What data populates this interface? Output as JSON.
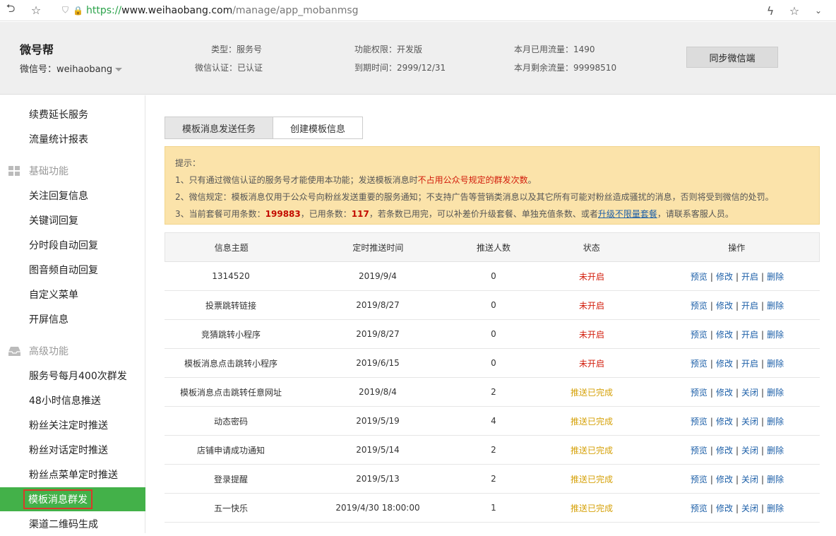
{
  "browser": {
    "url_scheme": "https://",
    "url_host": "www.weihaobang.com",
    "url_path": "/manage/app_mobanmsg"
  },
  "header": {
    "brand": "微号帮",
    "wxid_label": "微信号：weihaobang",
    "type": "类型：服务号",
    "auth": "微信认证：已认证",
    "permission": "功能权限：开发版",
    "expire": "到期时间：2999/12/31",
    "used_flow": "本月已用流量：1490",
    "left_flow": "本月剩余流量：99998510",
    "sync_button": "同步微信端"
  },
  "sidebar": {
    "items_top": [
      "续费延长服务",
      "流量统计报表"
    ],
    "section_basic": "基础功能",
    "items_basic": [
      "关注回复信息",
      "关键词回复",
      "分时段自动回复",
      "图音频自动回复",
      "自定义菜单",
      "开屏信息"
    ],
    "section_advanced": "高级功能",
    "items_advanced": [
      "服务号每月400次群发",
      "48小时信息推送",
      "粉丝关注定时推送",
      "粉丝对话定时推送",
      "粉丝点菜单定时推送"
    ],
    "active_item": "模板消息群发",
    "item_after": "渠道二维码生成"
  },
  "tabs": [
    "模板消息发送任务",
    "创建模板信息"
  ],
  "notice": {
    "title": "提示：",
    "line1_a": "1、只有通过微信认证的服务号才能使用本功能；发送模板消息时",
    "line1_red": "不占用公众号规定的群发次数",
    "line1_b": "。",
    "line2": "2、微信规定：模板消息仅用于公众号向粉丝发送重要的服务通知；不支持广告等营销类消息以及其它所有可能对粉丝造成骚扰的消息，否则将受到微信的处罚。",
    "line3_a": "3、当前套餐可用条数：",
    "line3_avail": "199883",
    "line3_b": "，已用条数：",
    "line3_used": "117",
    "line3_c": "，若条数已用完，可以补差价升级套餐、单独充值条数、或者",
    "line3_link": "升级不限量套餐",
    "line3_d": "，请联系客服人员。"
  },
  "table": {
    "headers": [
      "信息主题",
      "定时推送时间",
      "推送人数",
      "状态",
      "操作"
    ],
    "rows": [
      {
        "topic": "1314520",
        "time": "2019/9/4",
        "count": "0",
        "status": "未开启",
        "ops": [
          "预览",
          "修改",
          "开启",
          "删除"
        ]
      },
      {
        "topic": "投票跳转链接",
        "time": "2019/8/27",
        "count": "0",
        "status": "未开启",
        "ops": [
          "预览",
          "修改",
          "开启",
          "删除"
        ]
      },
      {
        "topic": "竞猜跳转小程序",
        "time": "2019/8/27",
        "count": "0",
        "status": "未开启",
        "ops": [
          "预览",
          "修改",
          "开启",
          "删除"
        ]
      },
      {
        "topic": "模板消息点击跳转小程序",
        "time": "2019/6/15",
        "count": "0",
        "status": "未开启",
        "ops": [
          "预览",
          "修改",
          "开启",
          "删除"
        ]
      },
      {
        "topic": "模板消息点击跳转任意网址",
        "time": "2019/8/4",
        "count": "2",
        "status": "推送已完成",
        "ops": [
          "预览",
          "修改",
          "关闭",
          "删除"
        ]
      },
      {
        "topic": "动态密码",
        "time": "2019/5/19",
        "count": "4",
        "status": "推送已完成",
        "ops": [
          "预览",
          "修改",
          "关闭",
          "删除"
        ]
      },
      {
        "topic": "店铺申请成功通知",
        "time": "2019/5/14",
        "count": "2",
        "status": "推送已完成",
        "ops": [
          "预览",
          "修改",
          "关闭",
          "删除"
        ]
      },
      {
        "topic": "登录提醒",
        "time": "2019/5/13",
        "count": "2",
        "status": "推送已完成",
        "ops": [
          "预览",
          "修改",
          "关闭",
          "删除"
        ]
      },
      {
        "topic": "五一快乐",
        "time": "2019/4/30 18:00:00",
        "count": "1",
        "status": "推送已完成",
        "ops": [
          "预览",
          "修改",
          "关闭",
          "删除"
        ]
      }
    ]
  }
}
